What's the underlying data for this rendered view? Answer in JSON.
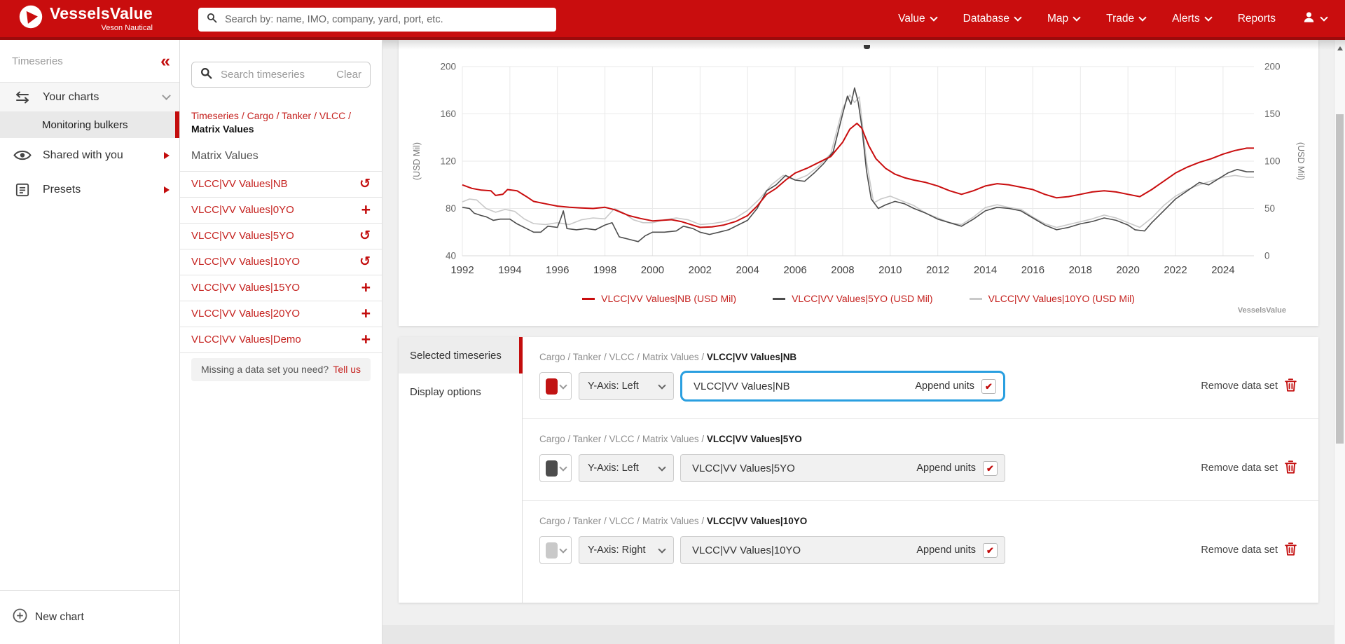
{
  "header": {
    "brand": {
      "name": "VesselsValue",
      "subtitle": "Veson Nautical"
    },
    "search_placeholder": "Search by: name, IMO, company, yard, port, etc.",
    "nav": [
      {
        "label": "Value",
        "dropdown": true
      },
      {
        "label": "Database",
        "dropdown": true
      },
      {
        "label": "Map",
        "dropdown": true
      },
      {
        "label": "Trade",
        "dropdown": true
      },
      {
        "label": "Alerts",
        "dropdown": true
      },
      {
        "label": "Reports",
        "dropdown": false
      }
    ],
    "bar_color": "#c90d0e"
  },
  "sidebar": {
    "title": "Timeseries",
    "collapse_icon": "collapse-double-chevron",
    "your_charts_label": "Your charts",
    "selected_chart": "Monitoring bulkers",
    "shared_label": "Shared with you",
    "presets_label": "Presets",
    "new_chart_label": "New chart"
  },
  "timeseries_panel": {
    "search_placeholder": "Search timeseries",
    "clear_label": "Clear",
    "breadcrumb": {
      "links": [
        "Timeseries",
        "Cargo",
        "Tanker",
        "VLCC"
      ],
      "current": "Matrix Values"
    },
    "section_title": "Matrix Values",
    "items": [
      {
        "label": "VLCC|VV Values|NB",
        "action": "undo-icon"
      },
      {
        "label": "VLCC|VV Values|0YO",
        "action": "add-icon"
      },
      {
        "label": "VLCC|VV Values|5YO",
        "action": "undo-icon"
      },
      {
        "label": "VLCC|VV Values|10YO",
        "action": "undo-icon"
      },
      {
        "label": "VLCC|VV Values|15YO",
        "action": "add-icon"
      },
      {
        "label": "VLCC|VV Values|20YO",
        "action": "add-icon"
      },
      {
        "label": "VLCC|VV Values|Demo",
        "action": "add-icon"
      }
    ],
    "missing": {
      "question": "Missing a data set you need?",
      "link": "Tell us"
    }
  },
  "chart_data": {
    "type": "line",
    "grid": true,
    "legend_position": "bottom",
    "legend_text_color": "#c5221f",
    "watermark": "VesselsValue",
    "x_range": [
      1992,
      2025.3
    ],
    "x_ticks": [
      1992,
      1994,
      1996,
      1998,
      2000,
      2002,
      2004,
      2006,
      2008,
      2010,
      2012,
      2014,
      2016,
      2018,
      2020,
      2022,
      2024
    ],
    "left_axis": {
      "label": "(USD Mil)",
      "ticks": [
        200,
        160,
        120,
        80,
        40
      ],
      "range": [
        40,
        200
      ]
    },
    "right_axis": {
      "label": "(USD Mil)",
      "ticks": [
        200,
        150,
        100,
        50,
        0
      ],
      "range": [
        0,
        200
      ]
    },
    "series": [
      {
        "name": "VLCC|VV Values|10YO (USD Mil)",
        "axis": "right",
        "color": "#c9c9c9",
        "width": 1.6,
        "points": [
          [
            1992,
            57
          ],
          [
            1992.3,
            60
          ],
          [
            1992.6,
            59
          ],
          [
            1993,
            50
          ],
          [
            1993.4,
            46
          ],
          [
            1993.8,
            49
          ],
          [
            1994.2,
            47
          ],
          [
            1994.6,
            39
          ],
          [
            1995,
            34
          ],
          [
            1995.5,
            33
          ],
          [
            1996,
            35
          ],
          [
            1996.5,
            33
          ],
          [
            1997,
            38
          ],
          [
            1997.5,
            40
          ],
          [
            1998,
            39
          ],
          [
            1998.4,
            50
          ],
          [
            1998.8,
            45
          ],
          [
            1999.2,
            38
          ],
          [
            1999.6,
            35
          ],
          [
            2000,
            35
          ],
          [
            2000.5,
            38
          ],
          [
            2001,
            40
          ],
          [
            2001.5,
            38
          ],
          [
            2002,
            33
          ],
          [
            2002.5,
            34
          ],
          [
            2003,
            36
          ],
          [
            2003.5,
            40
          ],
          [
            2004,
            48
          ],
          [
            2004.5,
            60
          ],
          [
            2005,
            75
          ],
          [
            2005.5,
            85
          ],
          [
            2006,
            80
          ],
          [
            2006.5,
            85
          ],
          [
            2007,
            95
          ],
          [
            2007.5,
            108
          ],
          [
            2008,
            156
          ],
          [
            2008.3,
            170
          ],
          [
            2008.5,
            162
          ],
          [
            2008.7,
            168
          ],
          [
            2009,
            100
          ],
          [
            2009.3,
            56
          ],
          [
            2009.6,
            60
          ],
          [
            2010,
            63
          ],
          [
            2010.5,
            58
          ],
          [
            2011,
            53
          ],
          [
            2011.5,
            45
          ],
          [
            2012,
            40
          ],
          [
            2012.5,
            35
          ],
          [
            2013,
            33
          ],
          [
            2013.5,
            41
          ],
          [
            2014,
            51
          ],
          [
            2014.5,
            54
          ],
          [
            2015,
            51
          ],
          [
            2015.5,
            49
          ],
          [
            2016,
            41
          ],
          [
            2016.5,
            34
          ],
          [
            2017,
            30
          ],
          [
            2017.5,
            33
          ],
          [
            2018,
            36
          ],
          [
            2018.5,
            39
          ],
          [
            2019,
            43
          ],
          [
            2019.5,
            40
          ],
          [
            2020,
            35
          ],
          [
            2020.5,
            30
          ],
          [
            2021,
            40
          ],
          [
            2021.5,
            53
          ],
          [
            2022,
            63
          ],
          [
            2022.5,
            70
          ],
          [
            2023,
            75
          ],
          [
            2023.5,
            79
          ],
          [
            2024,
            83
          ],
          [
            2024.5,
            85
          ],
          [
            2025,
            83
          ],
          [
            2025.3,
            83
          ]
        ]
      },
      {
        "name": "VLCC|VV Values|5YO (USD Mil)",
        "axis": "left",
        "color": "#4d4d4d",
        "width": 1.6,
        "points": [
          [
            1992,
            81
          ],
          [
            1992.3,
            80
          ],
          [
            1992.5,
            76
          ],
          [
            1992.8,
            74
          ],
          [
            1993,
            73
          ],
          [
            1993.3,
            70
          ],
          [
            1993.6,
            71
          ],
          [
            1994,
            71
          ],
          [
            1994.3,
            67
          ],
          [
            1994.7,
            63
          ],
          [
            1995,
            60
          ],
          [
            1995.3,
            60
          ],
          [
            1995.6,
            65
          ],
          [
            1996,
            64
          ],
          [
            1996.15,
            72
          ],
          [
            1996.25,
            78
          ],
          [
            1996.4,
            63
          ],
          [
            1996.8,
            62
          ],
          [
            1997.2,
            63
          ],
          [
            1997.6,
            62
          ],
          [
            1998,
            66
          ],
          [
            1998.3,
            68
          ],
          [
            1998.6,
            56
          ],
          [
            1999,
            54
          ],
          [
            1999.4,
            52
          ],
          [
            1999.7,
            57
          ],
          [
            2000,
            60
          ],
          [
            2000.5,
            60
          ],
          [
            2001,
            61
          ],
          [
            2001.3,
            65
          ],
          [
            2001.7,
            63
          ],
          [
            2002,
            60
          ],
          [
            2002.4,
            58
          ],
          [
            2002.8,
            60
          ],
          [
            2003.2,
            62
          ],
          [
            2003.6,
            66
          ],
          [
            2004,
            70
          ],
          [
            2004.4,
            80
          ],
          [
            2004.8,
            95
          ],
          [
            2005.2,
            100
          ],
          [
            2005.6,
            108
          ],
          [
            2006,
            104
          ],
          [
            2006.4,
            103
          ],
          [
            2006.8,
            110
          ],
          [
            2007.2,
            118
          ],
          [
            2007.6,
            128
          ],
          [
            2008,
            160
          ],
          [
            2008.2,
            175
          ],
          [
            2008.35,
            168
          ],
          [
            2008.5,
            182
          ],
          [
            2008.65,
            170
          ],
          [
            2008.8,
            150
          ],
          [
            2009,
            112
          ],
          [
            2009.2,
            88
          ],
          [
            2009.5,
            80
          ],
          [
            2009.8,
            83
          ],
          [
            2010.2,
            86
          ],
          [
            2010.6,
            84
          ],
          [
            2011,
            80
          ],
          [
            2011.5,
            76
          ],
          [
            2012,
            71
          ],
          [
            2012.5,
            68
          ],
          [
            2013,
            65
          ],
          [
            2013.5,
            71
          ],
          [
            2014,
            78
          ],
          [
            2014.5,
            81
          ],
          [
            2015,
            80
          ],
          [
            2015.5,
            78
          ],
          [
            2016,
            72
          ],
          [
            2016.5,
            66
          ],
          [
            2017,
            62
          ],
          [
            2017.5,
            64
          ],
          [
            2018,
            67
          ],
          [
            2018.5,
            69
          ],
          [
            2019,
            72
          ],
          [
            2019.5,
            70
          ],
          [
            2020,
            66
          ],
          [
            2020.3,
            62
          ],
          [
            2020.7,
            61
          ],
          [
            2021,
            68
          ],
          [
            2021.5,
            78
          ],
          [
            2022,
            88
          ],
          [
            2022.5,
            95
          ],
          [
            2023,
            102
          ],
          [
            2023.4,
            100
          ],
          [
            2023.8,
            105
          ],
          [
            2024.2,
            110
          ],
          [
            2024.6,
            113
          ],
          [
            2025,
            111
          ],
          [
            2025.3,
            111
          ]
        ]
      },
      {
        "name": "VLCC|VV Values|NB (USD Mil)",
        "axis": "left",
        "color": "#c90d0e",
        "width": 2,
        "points": [
          [
            1992,
            100
          ],
          [
            1992.4,
            97
          ],
          [
            1992.8,
            95.5
          ],
          [
            1993.2,
            95
          ],
          [
            1993.4,
            91
          ],
          [
            1993.7,
            92
          ],
          [
            1993.9,
            96
          ],
          [
            1994.3,
            95
          ],
          [
            1994.7,
            90
          ],
          [
            1995,
            86
          ],
          [
            1995.5,
            84
          ],
          [
            1996,
            82
          ],
          [
            1996.5,
            81
          ],
          [
            1997,
            80.5
          ],
          [
            1997.5,
            80
          ],
          [
            1998,
            81
          ],
          [
            1998.4,
            79
          ],
          [
            1999,
            74
          ],
          [
            1999.5,
            71.5
          ],
          [
            2000,
            69.5
          ],
          [
            2000.4,
            70
          ],
          [
            2000.8,
            70.5
          ],
          [
            2001.2,
            69
          ],
          [
            2001.6,
            66.5
          ],
          [
            2002,
            64
          ],
          [
            2002.5,
            64.5
          ],
          [
            2003,
            66
          ],
          [
            2003.5,
            69
          ],
          [
            2004,
            74
          ],
          [
            2004.4,
            82
          ],
          [
            2004.8,
            92
          ],
          [
            2005.2,
            97
          ],
          [
            2005.6,
            104
          ],
          [
            2006,
            110
          ],
          [
            2006.5,
            114
          ],
          [
            2007,
            119
          ],
          [
            2007.5,
            124
          ],
          [
            2008,
            136
          ],
          [
            2008.3,
            147
          ],
          [
            2008.6,
            152
          ],
          [
            2008.8,
            148
          ],
          [
            2009.1,
            133
          ],
          [
            2009.4,
            122
          ],
          [
            2009.8,
            114
          ],
          [
            2010.2,
            109
          ],
          [
            2010.6,
            106
          ],
          [
            2011,
            104
          ],
          [
            2011.5,
            102
          ],
          [
            2012,
            99
          ],
          [
            2012.5,
            95
          ],
          [
            2013,
            92
          ],
          [
            2013.5,
            95
          ],
          [
            2014,
            99
          ],
          [
            2014.5,
            101
          ],
          [
            2015,
            100
          ],
          [
            2015.5,
            98
          ],
          [
            2016,
            96
          ],
          [
            2016.5,
            92
          ],
          [
            2017,
            89
          ],
          [
            2017.5,
            90
          ],
          [
            2018,
            92
          ],
          [
            2018.5,
            94
          ],
          [
            2019,
            95
          ],
          [
            2019.5,
            94
          ],
          [
            2020,
            92
          ],
          [
            2020.5,
            90
          ],
          [
            2021,
            96
          ],
          [
            2021.5,
            103
          ],
          [
            2022,
            110
          ],
          [
            2022.5,
            115
          ],
          [
            2023,
            119
          ],
          [
            2023.5,
            122
          ],
          [
            2024,
            126
          ],
          [
            2024.5,
            129
          ],
          [
            2025,
            131
          ],
          [
            2025.3,
            131
          ]
        ]
      }
    ]
  },
  "selected_panel": {
    "tabs": [
      {
        "label": "Selected timeseries",
        "active": true
      },
      {
        "label": "Display options",
        "active": false
      }
    ],
    "rows": [
      {
        "breadcrumb": "Cargo / Tanker / VLCC / Matrix Values / ",
        "name": "VLCC|VV Values|NB",
        "swatch": "#c11313",
        "yaxis": "Y-Axis: Left",
        "value": "VLCC|VV Values|NB",
        "append_label": "Append units",
        "checked": true,
        "focused": true,
        "remove_label": "Remove data set"
      },
      {
        "breadcrumb": "Cargo / Tanker / VLCC / Matrix Values / ",
        "name": "VLCC|VV Values|5YO",
        "swatch": "#4d4d4d",
        "yaxis": "Y-Axis: Left",
        "value": "VLCC|VV Values|5YO",
        "append_label": "Append units",
        "checked": true,
        "focused": false,
        "remove_label": "Remove data set"
      },
      {
        "breadcrumb": "Cargo / Tanker / VLCC / Matrix Values / ",
        "name": "VLCC|VV Values|10YO",
        "swatch": "#c9c9c9",
        "yaxis": "Y-Axis: Right",
        "value": "VLCC|VV Values|10YO",
        "append_label": "Append units",
        "checked": true,
        "focused": false,
        "remove_label": "Remove data set"
      }
    ]
  }
}
